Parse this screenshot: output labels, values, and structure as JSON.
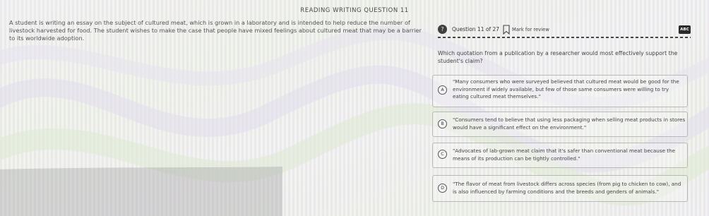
{
  "header": {
    "title": "READING WRITING QUESTION 11"
  },
  "passage": {
    "text": "A student is writing an essay on the subject of cultured meat, which is grown in a laboratory and is intended to help reduce the number of livestock harvested for food. The student wishes to make the case that people have mixed feelings about cultured meat that may be a barrier to its worldwide adoption."
  },
  "question": {
    "badge": "?",
    "number_label": "Question 11 of 27",
    "mark_label": "Mark for review",
    "abc_label": "ABC",
    "prompt": "Which quotation from a publication by a researcher would most effectively support the student's claim?"
  },
  "choices": [
    {
      "letter": "A",
      "text": "\"Many consumers who were surveyed believed that cultured meat would be good for the environment if widely available, but few of those same consumers were willing to try eating cultured meat themselves.\""
    },
    {
      "letter": "B",
      "text": "\"Consumers tend to believe that using less packaging when selling meat products in stores would have a significant effect on the environment.\""
    },
    {
      "letter": "C",
      "text": "\"Advocates of lab-grown meat claim that it's safer than conventional meat because the means of its production can be tightly controlled.\""
    },
    {
      "letter": "D",
      "text": "\"The flavor of meat from livestock differs across species (from pig to chicken to cow), and is also influenced by farming conditions and the breeds and genders of animals.\""
    }
  ],
  "icons": {
    "bookmark": "bookmark-icon",
    "help": "question-badge-icon"
  },
  "colors": {
    "badge": "#3f3f3f",
    "abc_button": "#2b2b2b",
    "border": "#b9b9b9"
  }
}
